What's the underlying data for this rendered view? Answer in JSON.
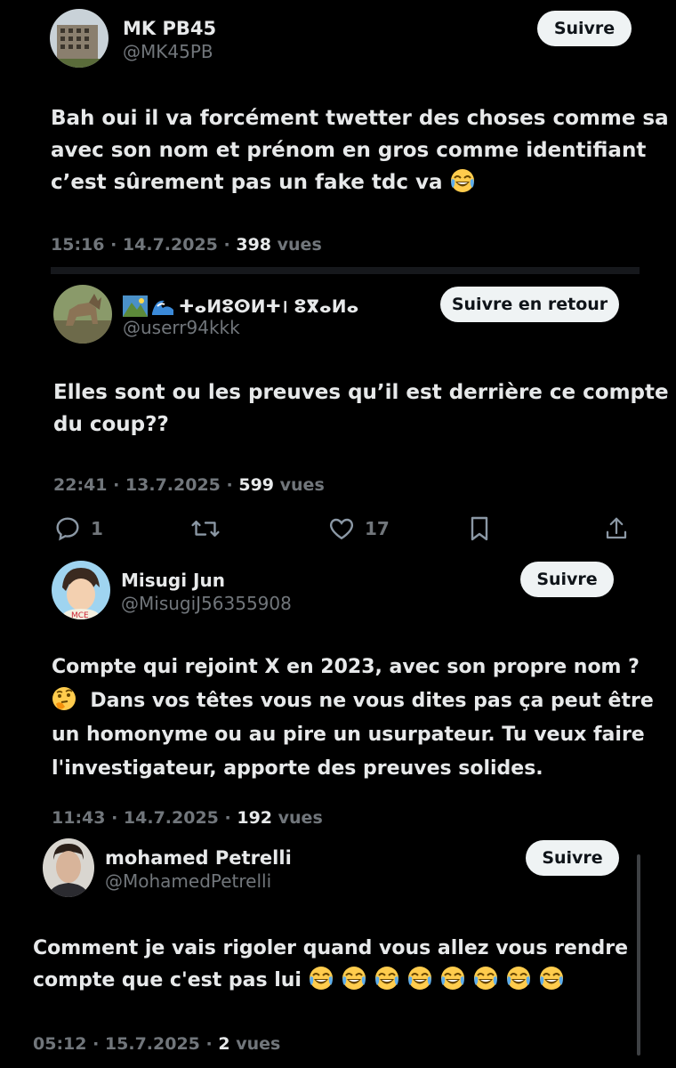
{
  "posts": [
    {
      "name": "MK PB45",
      "handle": "@MK45PB",
      "follow_label": "Suivre",
      "lines": [
        "Bah oui il va forcément twetter des choses comme sa",
        "avec son nom et prénom en gros comme identifiant",
        "c’est sûrement pas un fake tdc va"
      ],
      "time_date": "15:16 · 14.7.2025 · ",
      "views": "398",
      "views_label": " vues"
    },
    {
      "name": "ⵜⴰⵍⵓⵙⵍⵜ। ⵓⴳⴰⵍⴰ",
      "handle": "@userr94kkk",
      "follow_label": "Suivre en retour",
      "lines": [
        "Elles sont ou les preuves qu’il est derrière ce compte",
        "du coup??"
      ],
      "time_date": "22:41 · 13.7.2025 · ",
      "views": "599",
      "views_label": " vues",
      "actions": {
        "reply_count": "1",
        "retweet_count": "",
        "like_count": "17"
      }
    },
    {
      "name": "Misugi Jun",
      "handle": "@MisugiJ56355908",
      "follow_label": "Suivre",
      "lines": [
        "Compte qui rejoint X en 2023, avec son propre nom ?",
        "Dans vos têtes vous ne vous dites pas ça peut être",
        "un homonyme ou au pire un usurpateur. Tu veux faire",
        "l'investigateur, apporte des preuves solides."
      ],
      "time_date": "11:43 · 14.7.2025 · ",
      "views": "192",
      "views_label": " vues"
    },
    {
      "name": "mohamed Petrelli",
      "handle": "@MohamedPetrelli",
      "follow_label": "Suivre",
      "lines": [
        "Comment je vais rigoler quand vous allez vous rendre",
        "compte que c'est pas lui"
      ],
      "time_date": "05:12 · 15.7.2025 · ",
      "views": "2",
      "views_label": " vues"
    }
  ],
  "icons": {
    "laugh": "face-with-tears-of-joy-icon",
    "thinking": "thinking-face-icon",
    "reply": "reply-icon",
    "retweet": "retweet-icon",
    "like": "heart-icon",
    "bookmark": "bookmark-icon",
    "share": "share-icon"
  },
  "colors": {
    "background": "#000000",
    "text": "#e7e9ea",
    "muted": "#71767b",
    "button_bg": "#eff3f4",
    "button_text": "#0f1419"
  }
}
